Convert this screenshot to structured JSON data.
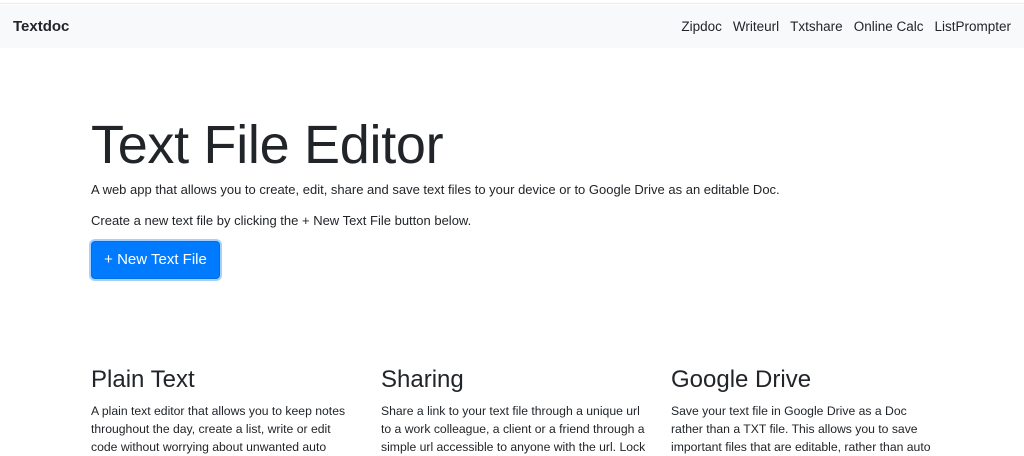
{
  "navbar": {
    "brand": "Textdoc",
    "links": [
      "Zipdoc",
      "Writeurl",
      "Txtshare",
      "Online Calc",
      "ListPrompter"
    ]
  },
  "hero": {
    "title": "Text File Editor",
    "lead": "A web app that allows you to create, edit, share and save text files to your device or to Google Drive as an editable Doc.",
    "hint": "Create a new text file by clicking the + New Text File button below.",
    "button_label": "+ New Text File"
  },
  "features": [
    {
      "title": "Plain Text",
      "lines": [
        "A plain text editor that allows you to keep notes",
        "throughout the day, create a list, write or edit",
        "code without worrying about unwanted auto"
      ]
    },
    {
      "title": "Sharing",
      "lines": [
        "Share a link to your text file through a unique url",
        "to a work colleague, a client or a friend through a",
        "simple url accessible to anyone with the url. Lock"
      ]
    },
    {
      "title": "Google Drive",
      "lines": [
        "Save your text file in Google Drive as a Doc",
        "rather than a TXT file. This allows you to save",
        "important files that are editable, rather than auto"
      ]
    }
  ],
  "colors": {
    "primary": "#007bff",
    "navbar_bg": "#f8f9fa",
    "text": "#212529"
  }
}
